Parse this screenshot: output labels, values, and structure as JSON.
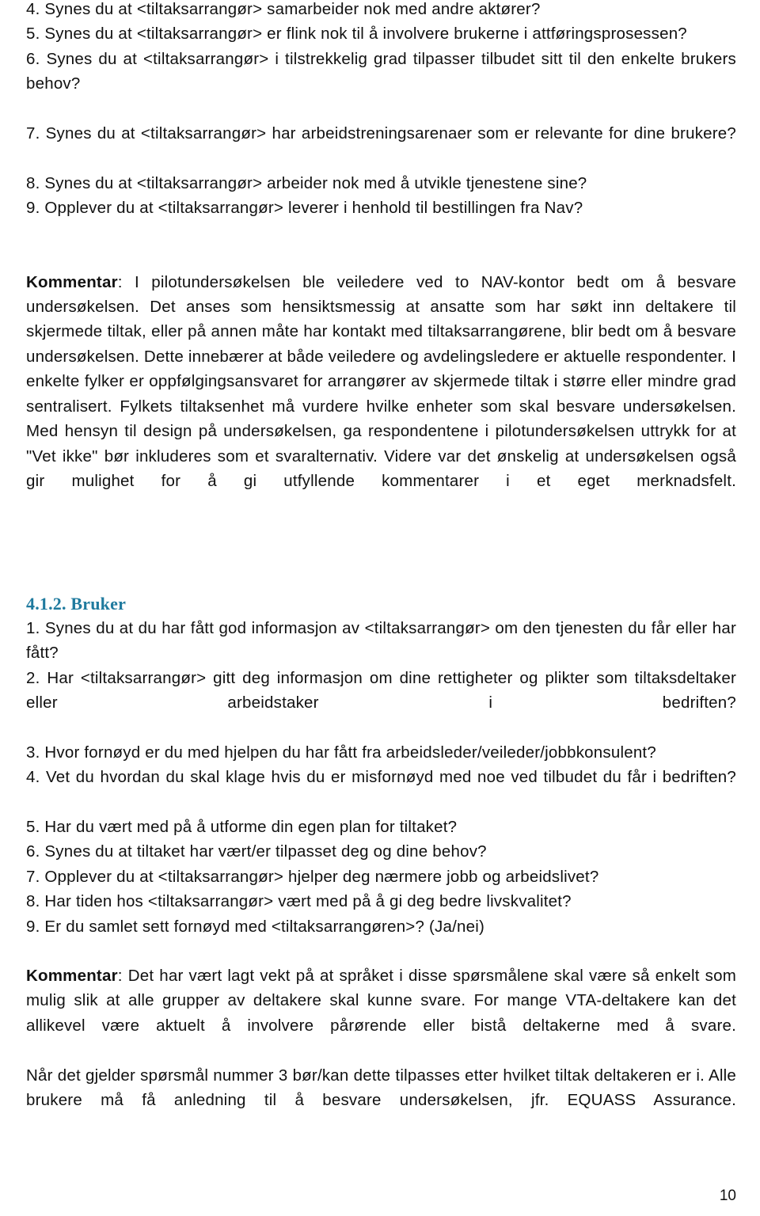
{
  "document": {
    "page_number": "10",
    "heading_color": "#1F7A9E",
    "body_color": "#111111"
  },
  "section_tiltaksarrangor_questions": {
    "q4": "4. Synes du at <tiltaksarrangør> samarbeider nok med andre aktører?",
    "q5": "5. Synes du at <tiltaksarrangør> er flink nok til å involvere brukerne i attføringsprosessen?",
    "q6": "6. Synes du at <tiltaksarrangør> i tilstrekkelig grad tilpasser tilbudet sitt til den enkelte brukers behov?",
    "q7": "7. Synes du at <tiltaksarrangør> har arbeidstreningsarenaer som er relevante for dine brukere?",
    "q8": "8. Synes du at <tiltaksarrangør> arbeider nok med å utvikle tjenestene sine?",
    "q9": "9. Opplever du at <tiltaksarrangør> leverer i henhold til bestillingen fra Nav?"
  },
  "kommentar_first": {
    "label": "Kommentar",
    "text": ": I pilotundersøkelsen ble veiledere ved to NAV-kontor bedt om å besvare undersøkelsen. Det anses som hensiktsmessig at ansatte som har søkt inn deltakere til skjermede tiltak, eller på annen måte har kontakt med tiltaksarrangørene, blir bedt om å besvare undersøkelsen. Dette innebærer at både veiledere og avdelingsledere er aktuelle respondenter. I enkelte fylker er oppfølgingsansvaret for arrangører av skjermede tiltak i større eller mindre grad sentralisert. Fylkets tiltaksenhet må vurdere hvilke enheter som skal besvare undersøkelsen. Med hensyn til design på undersøkelsen, ga respondentene i pilotundersøkelsen uttrykk for at \"Vet ikke\" bør inkluderes som et svaralternativ. Videre var det ønskelig at undersøkelsen også gir mulighet for å gi utfyllende kommentarer i et eget merknadsfelt."
  },
  "section_bruker": {
    "heading": "4.1.2. Bruker",
    "q1": "1. Synes du at du har fått god informasjon av <tiltaksarrangør> om den tjenesten du får eller har fått?",
    "q2": "2. Har <tiltaksarrangør> gitt deg informasjon om dine rettigheter og plikter som tiltaksdeltaker eller arbeidstaker i bedriften?",
    "q3": "3. Hvor fornøyd er du med hjelpen du har fått fra arbeidsleder/veileder/jobbkonsulent?",
    "q4": "4. Vet du hvordan du skal klage hvis du er misfornøyd med noe ved tilbudet du får i bedriften?",
    "q5": "5. Har du vært med på å utforme din egen plan for tiltaket?",
    "q6": "6. Synes du at tiltaket har vært/er tilpasset deg og dine behov?",
    "q7": "7. Opplever du at <tiltaksarrangør> hjelper deg nærmere jobb og arbeidslivet?",
    "q8": "8. Har tiden hos <tiltaksarrangør> vært med på å gi deg bedre livskvalitet?",
    "q9": "9. Er du samlet sett fornøyd med <tiltaksarrangøren>? (Ja/nei)"
  },
  "kommentar_second": {
    "label": "Kommentar",
    "text_line1": ": Det har vært lagt vekt på at språket i disse spørsmålene skal være så enkelt som mulig slik at alle grupper av deltakere skal kunne svare. For mange VTA-deltakere kan det allikevel være aktuelt å involvere pårørende eller bistå deltakerne med å svare.",
    "text_line2": "Når det gjelder spørsmål nummer 3 bør/kan dette tilpasses etter hvilket tiltak deltakeren er i. Alle brukere må få anledning til å besvare undersøkelsen, jfr. EQUASS Assurance."
  }
}
